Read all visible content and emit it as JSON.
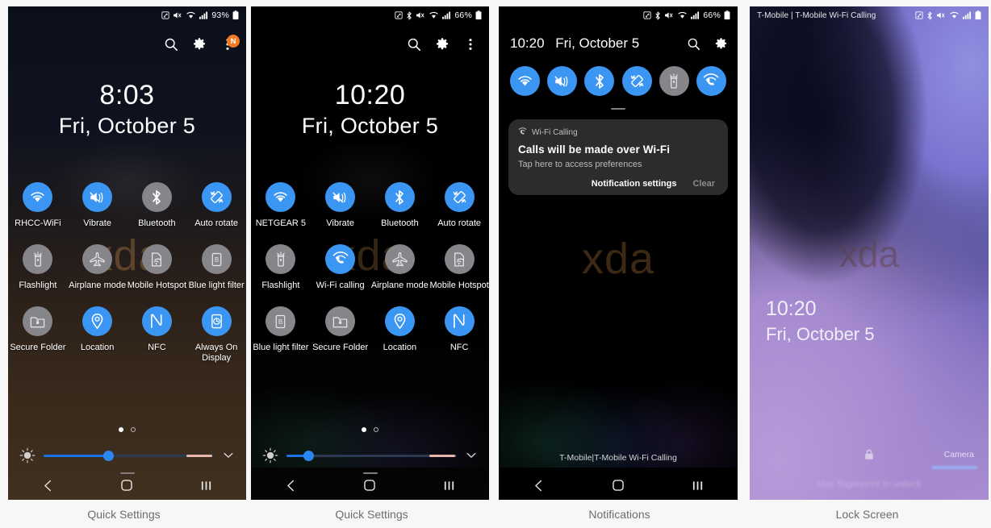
{
  "captions": [
    "Quick Settings",
    "Quick Settings",
    "Notifications",
    "Lock Screen"
  ],
  "panel1": {
    "status": {
      "battery_percent": "93%",
      "icons": [
        "nfc-icon",
        "mute-icon",
        "wifi-icon",
        "signal-icon",
        "battery-icon"
      ]
    },
    "header_icons": [
      "search-icon",
      "gear-icon",
      "overflow-menu-icon"
    ],
    "badge": "N",
    "clock": {
      "time": "8:03",
      "date": "Fri, October 5"
    },
    "watermark": "xda",
    "tiles": [
      {
        "label": "RHCC-WiFi",
        "icon": "wifi-icon",
        "state": "on"
      },
      {
        "label": "Vibrate",
        "icon": "vibrate-icon",
        "state": "on"
      },
      {
        "label": "Bluetooth",
        "icon": "bluetooth-icon",
        "state": "off"
      },
      {
        "label": "Auto rotate",
        "icon": "auto-rotate-icon",
        "state": "on"
      },
      {
        "label": "Flashlight",
        "icon": "flashlight-icon",
        "state": "off"
      },
      {
        "label": "Airplane mode",
        "icon": "airplane-icon",
        "state": "off"
      },
      {
        "label": "Mobile Hotspot",
        "icon": "hotspot-icon",
        "state": "off"
      },
      {
        "label": "Blue light filter",
        "icon": "blue-light-icon",
        "state": "off"
      },
      {
        "label": "Secure Folder",
        "icon": "secure-folder-icon",
        "state": "off"
      },
      {
        "label": "Location",
        "icon": "location-icon",
        "state": "on"
      },
      {
        "label": "NFC",
        "icon": "nfc-tile-icon",
        "state": "on"
      },
      {
        "label": "Always On Display",
        "icon": "aod-icon",
        "state": "on"
      }
    ],
    "pages": {
      "current": 1,
      "total": 2
    },
    "brightness": {
      "value_percent": 38
    },
    "nav": [
      "back-button",
      "home-button",
      "recents-button"
    ]
  },
  "panel2": {
    "status": {
      "battery_percent": "66%",
      "icons": [
        "nfc-icon",
        "bluetooth-icon",
        "mute-icon",
        "wifi-icon",
        "signal-icon",
        "battery-icon"
      ]
    },
    "header_icons": [
      "search-icon",
      "gear-icon",
      "overflow-menu-icon"
    ],
    "clock": {
      "time": "10:20",
      "date": "Fri, October 5"
    },
    "watermark": "xda",
    "tiles": [
      {
        "label": "NETGEAR 5",
        "icon": "wifi-icon",
        "state": "on"
      },
      {
        "label": "Vibrate",
        "icon": "vibrate-icon",
        "state": "on"
      },
      {
        "label": "Bluetooth",
        "icon": "bluetooth-icon",
        "state": "on"
      },
      {
        "label": "Auto rotate",
        "icon": "auto-rotate-icon",
        "state": "on"
      },
      {
        "label": "Flashlight",
        "icon": "flashlight-icon",
        "state": "off"
      },
      {
        "label": "Wi-Fi calling",
        "icon": "wifi-calling-icon",
        "state": "on"
      },
      {
        "label": "Airplane mode",
        "icon": "airplane-icon",
        "state": "off"
      },
      {
        "label": "Mobile Hotspot",
        "icon": "hotspot-icon",
        "state": "off"
      },
      {
        "label": "Blue light filter",
        "icon": "blue-light-icon",
        "state": "off"
      },
      {
        "label": "Secure Folder",
        "icon": "secure-folder-icon",
        "state": "off"
      },
      {
        "label": "Location",
        "icon": "location-icon",
        "state": "on"
      },
      {
        "label": "NFC",
        "icon": "nfc-tile-icon",
        "state": "on"
      }
    ],
    "pages": {
      "current": 1,
      "total": 2
    },
    "brightness": {
      "value_percent": 13
    },
    "nav": [
      "back-button",
      "home-button",
      "recents-button"
    ]
  },
  "panel3": {
    "status": {
      "battery_percent": "66%",
      "icons": [
        "nfc-icon",
        "bluetooth-icon",
        "mute-icon",
        "wifi-icon",
        "signal-icon",
        "battery-icon"
      ]
    },
    "header": {
      "time": "10:20",
      "date": "Fri, October 5",
      "icons": [
        "search-icon",
        "gear-icon"
      ]
    },
    "quick_toggles": [
      {
        "icon": "wifi-icon",
        "state": "on"
      },
      {
        "icon": "vibrate-icon",
        "state": "on"
      },
      {
        "icon": "bluetooth-icon",
        "state": "on"
      },
      {
        "icon": "auto-rotate-icon",
        "state": "on"
      },
      {
        "icon": "flashlight-icon",
        "state": "off"
      },
      {
        "icon": "wifi-calling-icon",
        "state": "on"
      }
    ],
    "notification": {
      "app": "Wi-Fi Calling",
      "title": "Calls will be made over Wi-Fi",
      "subtitle": "Tap here to access preferences",
      "actions": [
        "Notification settings",
        "Clear"
      ]
    },
    "watermark": "xda",
    "carrier": "T-Mobile|T-Mobile Wi-Fi Calling",
    "nav": [
      "back-button",
      "home-button",
      "recents-button"
    ]
  },
  "panel4": {
    "status": {
      "carrier": "T-Mobile | T-Mobile Wi-Fi Calling",
      "icons": [
        "nfc-icon",
        "bluetooth-icon",
        "mute-icon",
        "wifi-icon",
        "signal-icon",
        "battery-icon"
      ]
    },
    "clock": {
      "time": "10:20",
      "date": "Fri, October 5"
    },
    "watermark": "xda",
    "lock_icon": "lock-icon",
    "camera_label": "Camera",
    "hint": "Use fingerprint to unlock"
  },
  "colors": {
    "accent_on": "#3b95f3",
    "tile_off": "#85858a",
    "badge": "#f47920",
    "slider": "#1a73e8",
    "caption_text": "#6d6d6d"
  }
}
